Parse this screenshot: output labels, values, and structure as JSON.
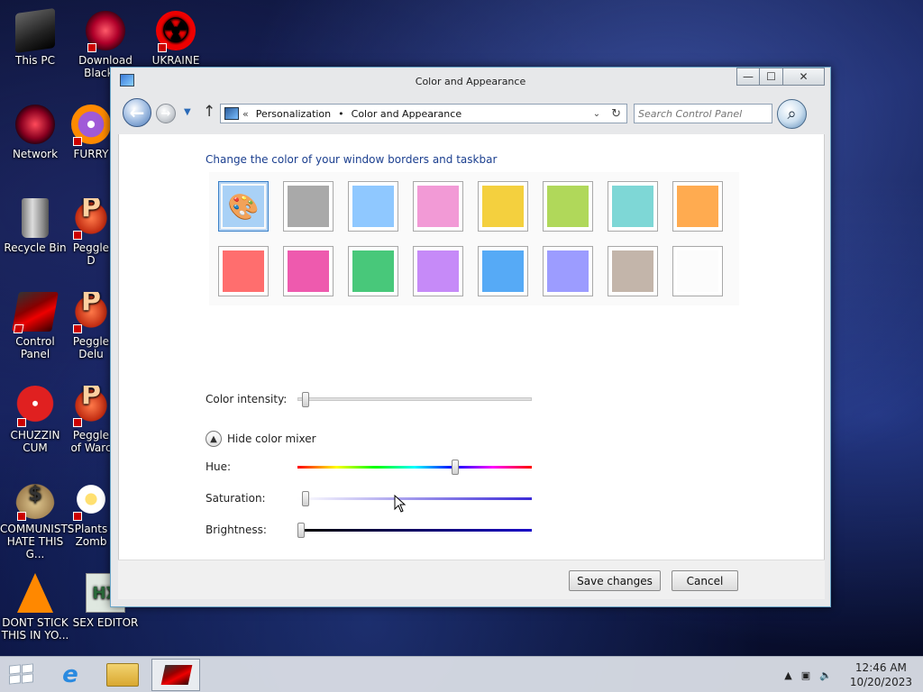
{
  "desktop": {
    "icons": [
      {
        "label": "This PC"
      },
      {
        "label": "Download Black ..."
      },
      {
        "label": "UKRAINE"
      },
      {
        "label": "Network"
      },
      {
        "label": "FURRY"
      },
      {
        "label": "Recycle Bin"
      },
      {
        "label": "Peggle D"
      },
      {
        "label": "Control Panel"
      },
      {
        "label": "Peggle Delu"
      },
      {
        "label": "CHUZZIN CUM"
      },
      {
        "label": "Peggle of Warc"
      },
      {
        "label": "COMMUNISTS HATE THIS G..."
      },
      {
        "label": "Plants Zomb"
      },
      {
        "label": "DONT STICK THIS IN YO..."
      },
      {
        "label": "SEX EDITOR"
      }
    ]
  },
  "window": {
    "title": "Color and Appearance",
    "controls": {
      "minimize": "—",
      "maximize": "☐",
      "close": "✕"
    },
    "nav": {
      "back_icon": "arrow-left-icon",
      "forward_icon": "arrow-right-icon",
      "up_icon": "arrow-up-icon",
      "breadcrumb_prefix": "«",
      "breadcrumb": [
        "Personalization",
        "Color and Appearance"
      ],
      "breadcrumb_sep": "•",
      "search_placeholder": "Search Control Panel"
    },
    "content": {
      "heading": "Change the color of your window borders and taskbar",
      "swatches": [
        {
          "name": "automatic",
          "color": "#a9d1f6",
          "selected": true
        },
        {
          "name": "gray",
          "color": "#a9a9a9"
        },
        {
          "name": "sky",
          "color": "#8fc8ff"
        },
        {
          "name": "pink",
          "color": "#f29ad6"
        },
        {
          "name": "yellow",
          "color": "#f4d03e"
        },
        {
          "name": "lime",
          "color": "#b0d85a"
        },
        {
          "name": "teal",
          "color": "#7ed7d6"
        },
        {
          "name": "orange",
          "color": "#ffab50"
        },
        {
          "name": "red",
          "color": "#ff6e6e"
        },
        {
          "name": "magenta",
          "color": "#ee5aae"
        },
        {
          "name": "green",
          "color": "#48c87a"
        },
        {
          "name": "violet",
          "color": "#c68af8"
        },
        {
          "name": "blue",
          "color": "#56aaf6"
        },
        {
          "name": "periwinkle",
          "color": "#9c9cff"
        },
        {
          "name": "taupe",
          "color": "#c3b5aa"
        },
        {
          "name": "white",
          "color": "#fcfcfc"
        }
      ],
      "color_intensity_label": "Color intensity:",
      "color_intensity": 0.02,
      "mixer_toggle_label": "Hide color mixer",
      "hue_label": "Hue:",
      "hue": 0.68,
      "saturation_label": "Saturation:",
      "saturation": 0.02,
      "brightness_label": "Brightness:",
      "brightness": 0.0
    },
    "footer": {
      "save_label": "Save changes",
      "cancel_label": "Cancel"
    }
  },
  "taskbar": {
    "start_icon": "windows-logo-icon",
    "pinned": [
      "internet-explorer-icon",
      "file-explorer-icon",
      "control-panel-icon"
    ],
    "time": "12:46 AM",
    "date": "10/20/2023"
  }
}
